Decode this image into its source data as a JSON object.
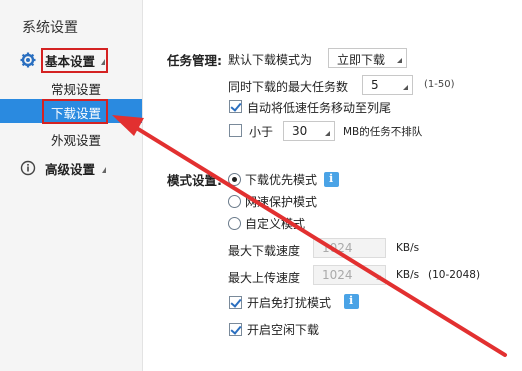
{
  "sidebar": {
    "title": "系统设置",
    "groups": [
      {
        "label": "基本设置",
        "icon": "gear-icon"
      },
      {
        "label": "高级设置",
        "icon": "info-icon"
      }
    ],
    "items": [
      {
        "label": "常规设置"
      },
      {
        "label": "下载设置"
      },
      {
        "label": "外观设置"
      }
    ]
  },
  "task": {
    "section_label": "任务管理:",
    "default_mode_label": "默认下载模式为",
    "default_mode_value": "立即下载",
    "max_tasks_label": "同时下载的最大任务数",
    "max_tasks_value": "5",
    "max_tasks_range": "(1-50)",
    "auto_move_label": "自动将低速任务移动至列尾",
    "less_than_label": "小于",
    "less_than_value": "30",
    "less_than_suffix": "MB的任务不排队"
  },
  "mode": {
    "section_label": "模式设置:",
    "options": [
      "下载优先模式",
      "网速保护模式",
      "自定义模式"
    ],
    "max_down_label": "最大下载速度",
    "max_down_value": "1024",
    "max_down_unit": "KB/s",
    "max_up_label": "最大上传速度",
    "max_up_value": "1024",
    "max_up_unit": "KB/s",
    "max_up_range": "(10-2048)",
    "no_disturb_label": "开启免打扰模式",
    "idle_download_label": "开启空闲下载"
  },
  "colors": {
    "accent": "#2a8ae0",
    "highlight_red": "#d42222"
  }
}
